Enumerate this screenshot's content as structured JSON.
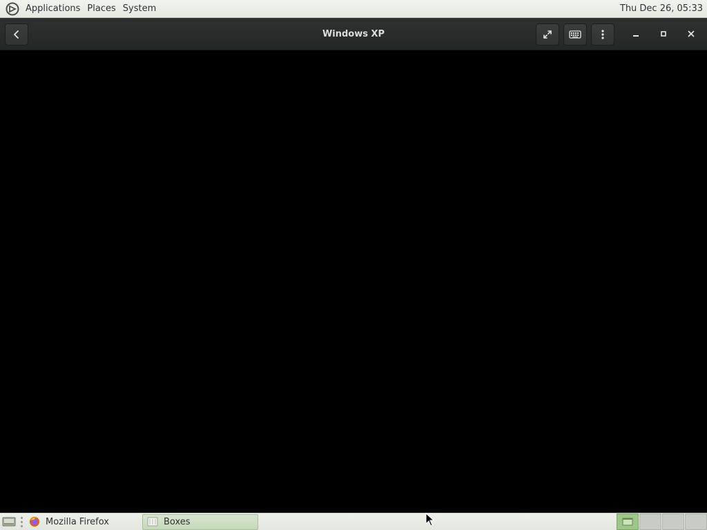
{
  "top_panel": {
    "menus": [
      "Applications",
      "Places",
      "System"
    ],
    "clock": "Thu Dec 26, 05:33"
  },
  "headerbar": {
    "title": "Windows XP",
    "icons": {
      "back": "back-arrow-icon",
      "fullscreen": "fullscreen-icon",
      "keyboard": "keyboard-icon",
      "menu": "vertical-dots-icon",
      "minimize": "minimize-icon",
      "maximize": "maximize-icon",
      "close": "close-icon"
    }
  },
  "taskbar": {
    "tasks": [
      {
        "label": "Mozilla Firefox",
        "icon": "firefox-icon",
        "active": false
      },
      {
        "label": "Boxes",
        "icon": "boxes-icon",
        "active": true
      }
    ],
    "workspaces": 4,
    "active_workspace": 1
  },
  "colors": {
    "panel_bg": "#e6e9e1",
    "headerbar_bg": "#2b2d2c",
    "vm_bg": "#000000",
    "active_accent": "#9fc58a"
  }
}
